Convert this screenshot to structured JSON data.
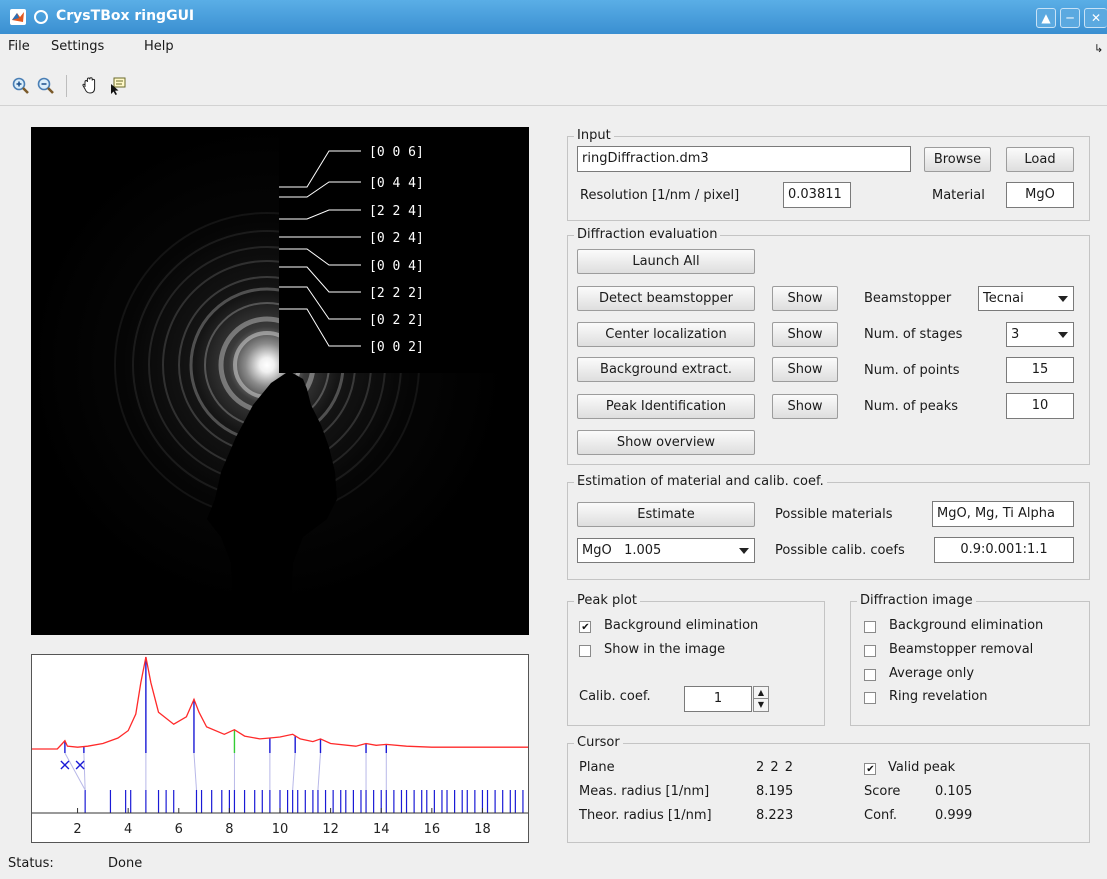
{
  "window": {
    "title": "CrysTBox ringGUI"
  },
  "menu": {
    "items": [
      "File",
      "Settings",
      "Help"
    ]
  },
  "toolbar": {
    "icons": [
      "zoom-in-icon",
      "zoom-out-icon",
      "pan-hand-icon",
      "data-cursor-icon"
    ]
  },
  "image": {
    "ring_labels": [
      "[0 0 6]",
      "[0 4 4]",
      "[2 2 4]",
      "[0 2 4]",
      "[0 0 4]",
      "[2 2 2]",
      "[0 2 2]",
      "[0 0 2]"
    ]
  },
  "plot": {
    "x_ticks": [
      "2",
      "4",
      "6",
      "8",
      "10",
      "12",
      "14",
      "16",
      "18"
    ]
  },
  "chart_data": {
    "type": "line",
    "xlim": [
      0.2,
      19.8
    ],
    "x_ticks": [
      2,
      4,
      6,
      8,
      10,
      12,
      14,
      16,
      18
    ],
    "profile": {
      "x": [
        0.2,
        1.2,
        1.4,
        1.5,
        1.6,
        2.0,
        2.4,
        3.0,
        3.6,
        4.0,
        4.3,
        4.5,
        4.7,
        4.9,
        5.2,
        5.8,
        6.3,
        6.6,
        6.8,
        7.1,
        7.8,
        8.2,
        8.6,
        9.2,
        9.6,
        10.0,
        10.5,
        10.8,
        11.3,
        11.6,
        12.0,
        13.0,
        13.4,
        13.8,
        14.2,
        15.0,
        16.0,
        17.0,
        18.0,
        19.8
      ],
      "y": [
        0.0,
        0.0,
        0.06,
        0.09,
        0.03,
        0.02,
        0.03,
        0.06,
        0.12,
        0.2,
        0.38,
        0.72,
        1.0,
        0.72,
        0.4,
        0.27,
        0.35,
        0.54,
        0.4,
        0.24,
        0.16,
        0.21,
        0.14,
        0.11,
        0.12,
        0.13,
        0.16,
        0.11,
        0.08,
        0.11,
        0.06,
        0.03,
        0.06,
        0.04,
        0.05,
        0.03,
        0.02,
        0.02,
        0.02,
        0.02
      ]
    },
    "peaks": [
      1.5,
      2.25,
      4.7,
      6.6,
      8.2,
      9.6,
      10.6,
      11.6,
      13.4,
      14.2
    ],
    "theoretical": [
      2.3,
      3.3,
      3.9,
      4.1,
      4.7,
      5.2,
      5.5,
      5.8,
      6.7,
      6.9,
      7.3,
      7.7,
      8.0,
      8.2,
      8.6,
      9.0,
      9.3,
      9.6,
      10.0,
      10.3,
      10.5,
      10.7,
      11.0,
      11.3,
      11.5,
      11.8,
      12.1,
      12.4,
      12.6,
      12.9,
      13.2,
      13.4,
      13.7,
      14.0,
      14.2,
      14.5,
      14.8,
      15.0,
      15.3,
      15.6,
      15.8,
      16.1,
      16.4,
      16.6,
      16.9,
      17.2,
      17.4,
      17.7,
      18.0,
      18.2,
      18.5,
      18.8,
      19.1,
      19.3,
      19.6
    ],
    "markers": [
      1.5,
      2.1
    ],
    "highlight_peak": 8.2
  },
  "status": {
    "label": "Status:",
    "value": "Done"
  },
  "input": {
    "title": "Input",
    "file": "ringDiffraction.dm3",
    "browse": "Browse",
    "load": "Load",
    "resolution_label": "Resolution [1/nm / pixel]",
    "resolution_value": "0.03811",
    "material_label": "Material",
    "material_value": "MgO"
  },
  "evaluation": {
    "title": "Diffraction evaluation",
    "launch_all": "Launch All",
    "detect": "Detect beamstopper",
    "center": "Center localization",
    "background": "Background extract.",
    "peak": "Peak Identification",
    "overview": "Show overview",
    "show": "Show",
    "beamstopper_label": "Beamstopper",
    "beamstopper_value": "Tecnai",
    "stages_label": "Num. of stages",
    "stages_value": "3",
    "points_label": "Num. of points",
    "points_value": "15",
    "peaks_label": "Num. of peaks",
    "peaks_value": "10"
  },
  "estimation": {
    "title": "Estimation of material and calib. coef.",
    "estimate": "Estimate",
    "materials_label": "Possible materials",
    "materials_value": "MgO, Mg, Ti Alpha",
    "result": "MgO   1.005",
    "coefs_label": "Possible calib. coefs",
    "coefs_value": "0.9:0.001:1.1"
  },
  "peakplot": {
    "title": "Peak plot",
    "bg_elim": "Background elimination",
    "show_image": "Show in the image",
    "calib_label": "Calib. coef.",
    "calib_value": "1"
  },
  "diffimage": {
    "title": "Diffraction image",
    "bg_elim": "Background elimination",
    "beam_removal": "Beamstopper removal",
    "average": "Average only",
    "ring": "Ring revelation"
  },
  "cursor": {
    "title": "Cursor",
    "plane_label": "Plane",
    "plane_value": "2 2 2",
    "meas_label": "Meas. radius [1/nm]",
    "meas_value": "8.195",
    "theor_label": "Theor. radius [1/nm]",
    "theor_value": "8.223",
    "valid_label": "Valid peak",
    "score_label": "Score",
    "score_value": "0.105",
    "conf_label": "Conf.",
    "conf_value": "0.999"
  }
}
